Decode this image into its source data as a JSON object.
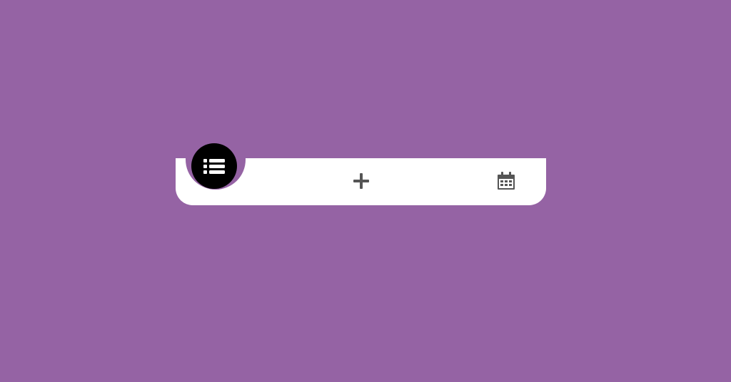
{
  "colors": {
    "background": "#9563a4",
    "bar": "#ffffff",
    "active_button": "#000000",
    "active_icon": "#ffffff",
    "inactive_icon": "#555555"
  },
  "nav": {
    "items": [
      {
        "id": "list",
        "icon": "list-icon",
        "active": true
      },
      {
        "id": "add",
        "icon": "plus-icon",
        "active": false
      },
      {
        "id": "calendar",
        "icon": "calendar-icon",
        "active": false
      }
    ]
  }
}
